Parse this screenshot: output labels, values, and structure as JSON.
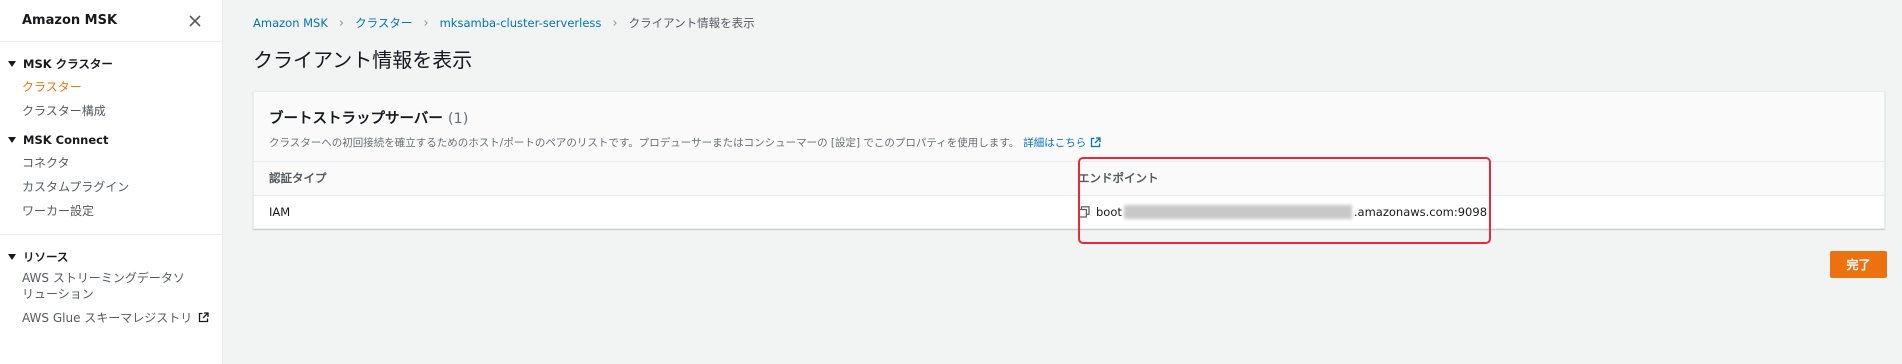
{
  "sidebar": {
    "title": "Amazon MSK",
    "groups": [
      {
        "label": "MSK クラスター",
        "items": [
          {
            "label": "クラスター",
            "active": true
          },
          {
            "label": "クラスター構成"
          }
        ]
      },
      {
        "label": "MSK Connect",
        "items": [
          {
            "label": "コネクタ"
          },
          {
            "label": "カスタムプラグイン"
          },
          {
            "label": "ワーカー設定"
          }
        ]
      },
      {
        "label": "リソース",
        "items": [
          {
            "label": "AWS ストリーミングデータソ\nリューション"
          },
          {
            "label": "AWS Glue スキーマレジストリ"
          }
        ]
      }
    ]
  },
  "breadcrumb": {
    "items": [
      "Amazon MSK",
      "クラスター",
      "mksamba-cluster-serverless"
    ],
    "current": "クライアント情報を表示"
  },
  "page": {
    "title": "クライアント情報を表示"
  },
  "panel": {
    "title": "ブートストラップサーバー",
    "count": "(1)",
    "description": "クラスターへの初回接続を確立するためのホスト/ポートのペアのリストです。プロデューサーまたはコンシューマーの [設定] でこのプロパティを使用します。",
    "learn_more": "詳細はこちら",
    "columns": [
      "認証タイプ",
      "エンドポイント"
    ],
    "rows": [
      {
        "auth_type": "IAM",
        "endpoint_prefix": "boot",
        "endpoint_suffix": ".amazonaws.com:9098"
      }
    ]
  },
  "actions": {
    "done_label": "完了"
  },
  "colors": {
    "accent": "#ec7211",
    "link": "#0073bb",
    "highlight": "#e8283e"
  },
  "icons": [
    "close-icon",
    "caret-down-icon",
    "external-link-icon",
    "copy-icon"
  ]
}
